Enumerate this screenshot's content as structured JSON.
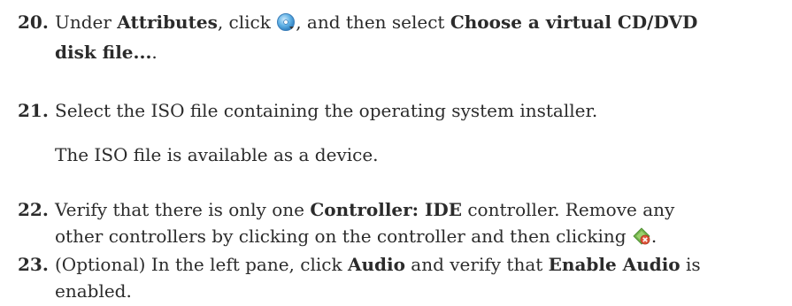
{
  "steps": [
    {
      "number": "20.",
      "line1_a": "Under ",
      "line1_b": "Attributes",
      "line1_c": ", click ",
      "line1_d": ", and then select ",
      "line1_e": "Choose a virtual CD/DVD",
      "line2_a": "disk file...",
      "line2_b": ".",
      "icon": "optical-disk-icon"
    },
    {
      "number": "21.",
      "text": "Select the ISO file containing the operating system installer.",
      "note": "The ISO file is available as a device."
    },
    {
      "number": "22.",
      "line1_a": "Verify that there is only one ",
      "line1_b": "Controller: IDE",
      "line1_c": " controller. Remove any",
      "line2_a": "other controllers by clicking on the controller and then clicking ",
      "line2_b": ".",
      "icon": "remove-controller-icon"
    },
    {
      "number": "23.",
      "line1_a": "(Optional) In the left pane, click ",
      "line1_b": "Audio",
      "line1_c": " and verify that ",
      "line1_d": "Enable Audio",
      "line1_e": " is",
      "line2_a": "enabled."
    }
  ],
  "colors": {
    "text": "#2b2b2b",
    "disk_icon": "#4aa3df",
    "remove_icon_green": "#6fb04a",
    "remove_icon_red": "#e0553a"
  }
}
